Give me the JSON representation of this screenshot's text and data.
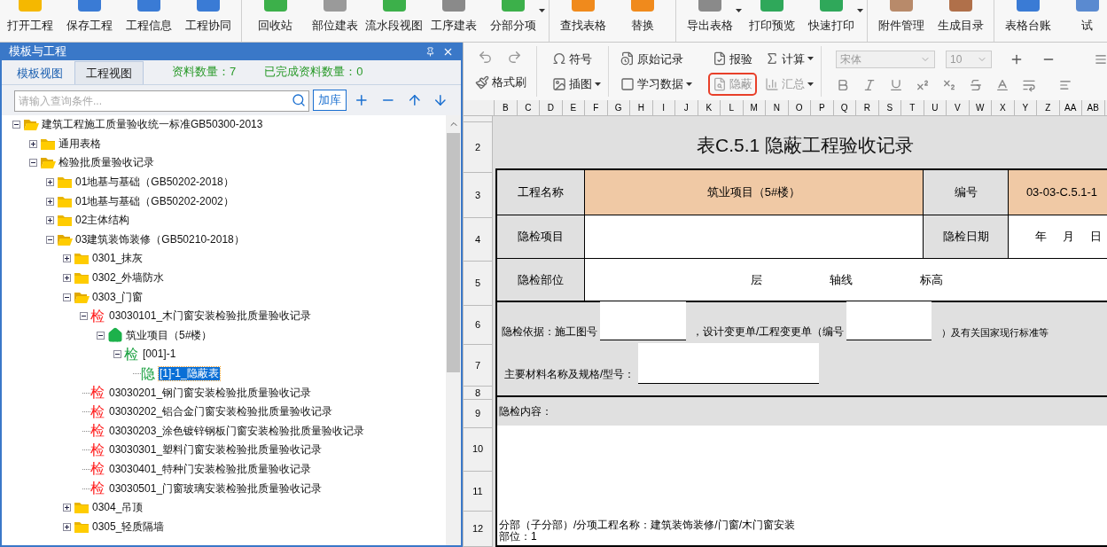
{
  "ribbon": {
    "groups": [
      [
        {
          "label": "打开工程",
          "dropdown": false
        },
        {
          "label": "保存工程",
          "dropdown": false
        },
        {
          "label": "工程信息",
          "dropdown": false
        },
        {
          "label": "工程协同",
          "dropdown": false
        }
      ],
      [
        {
          "label": "回收站",
          "dropdown": false
        },
        {
          "label": "部位建表",
          "dropdown": false
        },
        {
          "label": "流水段视图",
          "dropdown": false
        },
        {
          "label": "工序建表",
          "dropdown": false
        },
        {
          "label": "分部分项",
          "dropdown": true
        }
      ],
      [
        {
          "label": "查找表格",
          "dropdown": false
        },
        {
          "label": "替换",
          "dropdown": false
        }
      ],
      [
        {
          "label": "导出表格",
          "dropdown": true
        },
        {
          "label": "打印预览",
          "dropdown": false
        },
        {
          "label": "快速打印",
          "dropdown": true
        }
      ],
      [
        {
          "label": "附件管理",
          "dropdown": false
        },
        {
          "label": "生成目录",
          "dropdown": false
        }
      ],
      [
        {
          "label": "表格台账",
          "dropdown": false
        },
        {
          "label": "试",
          "dropdown": false
        }
      ]
    ]
  },
  "left_panel": {
    "title": "模板与工程",
    "tabs": [
      {
        "label": "模板视图",
        "selected": true
      },
      {
        "label": "工程视图",
        "selected": false
      }
    ],
    "counts": [
      "资料数量：7",
      "已完成资料数量：0"
    ],
    "search": {
      "placeholder": "请输入查询条件..."
    },
    "add_button": "加库",
    "tree": [
      {
        "label": "建筑工程施工质量验收统一标准GB50300-2013",
        "kind": "folder",
        "expanded": true,
        "selected": false,
        "children": [
          {
            "label": "通用表格",
            "kind": "folder",
            "expanded": false,
            "selected": false
          },
          {
            "label": "检验批质量验收记录",
            "kind": "folder",
            "expanded": true,
            "selected": false,
            "children": [
              {
                "label": "01地基与基础（GB50202-2018）",
                "kind": "folder",
                "expanded": false,
                "selected": false
              },
              {
                "label": "01地基与基础（GB50202-2002）",
                "kind": "folder",
                "expanded": false,
                "selected": false
              },
              {
                "label": "02主体结构",
                "kind": "folder",
                "expanded": false,
                "selected": false
              },
              {
                "label": "03建筑装饰装修（GB50210-2018）",
                "kind": "folder",
                "expanded": true,
                "selected": false,
                "children": [
                  {
                    "label": "0301_抹灰",
                    "kind": "folder",
                    "expanded": false,
                    "selected": false
                  },
                  {
                    "label": "0302_外墙防水",
                    "kind": "folder",
                    "expanded": false,
                    "selected": false
                  },
                  {
                    "label": "0303_门窗",
                    "kind": "folder",
                    "expanded": true,
                    "selected": false,
                    "children": [
                      {
                        "label": "03030101_木门窗安装检验批质量验收记录",
                        "kind": "record",
                        "badge": "检",
                        "color": "#ff2020",
                        "expanded": true,
                        "selected": false,
                        "children": [
                          {
                            "label": "筑业项目（5#楼）",
                            "kind": "project",
                            "expanded": true,
                            "selected": false,
                            "children": [
                              {
                                "label": "[001]-1",
                                "kind": "record",
                                "badge": "检",
                                "color": "#1aa040",
                                "expanded": true,
                                "selected": false,
                                "children": [
                                  {
                                    "label": "[1]-1_隐蔽表",
                                    "kind": "record",
                                    "badge": "隐",
                                    "color": "#1aa040",
                                    "selected": true
                                  }
                                ]
                              }
                            ]
                          }
                        ]
                      },
                      {
                        "label": "03030201_钢门窗安装检验批质量验收记录",
                        "kind": "record",
                        "badge": "检",
                        "color": "#ff2020",
                        "selected": false
                      },
                      {
                        "label": "03030202_铝合金门窗安装检验批质量验收记录",
                        "kind": "record",
                        "badge": "检",
                        "color": "#ff2020",
                        "selected": false
                      },
                      {
                        "label": "03030203_涂色镀锌钢板门窗安装检验批质量验收记录",
                        "kind": "record",
                        "badge": "检",
                        "color": "#ff2020",
                        "selected": false
                      },
                      {
                        "label": "03030301_塑料门窗安装检验批质量验收记录",
                        "kind": "record",
                        "badge": "检",
                        "color": "#ff2020",
                        "selected": false
                      },
                      {
                        "label": "03030401_特种门安装检验批质量验收记录",
                        "kind": "record",
                        "badge": "检",
                        "color": "#ff2020",
                        "selected": false
                      },
                      {
                        "label": "03030501_门窗玻璃安装检验批质量验收记录",
                        "kind": "record",
                        "badge": "检",
                        "color": "#ff2020",
                        "selected": false
                      }
                    ]
                  },
                  {
                    "label": "0304_吊顶",
                    "kind": "folder",
                    "expanded": false,
                    "selected": false
                  },
                  {
                    "label": "0305_轻质隔墙",
                    "kind": "folder",
                    "expanded": false,
                    "selected": false
                  }
                ]
              }
            ]
          }
        ]
      }
    ]
  },
  "toolbar": {
    "buttons": [
      {
        "label": "符号",
        "dropdown": false,
        "disabled": false,
        "highlighted": false
      },
      {
        "label": "原始记录",
        "dropdown": false,
        "disabled": false,
        "highlighted": false
      },
      {
        "label": "报验",
        "dropdown": false,
        "disabled": false,
        "highlighted": false
      },
      {
        "label": "计算",
        "dropdown": true,
        "disabled": false,
        "highlighted": false
      },
      {
        "label": "格式刷",
        "dropdown": false,
        "disabled": false,
        "highlighted": false
      },
      {
        "label": "插图",
        "dropdown": true,
        "disabled": false,
        "highlighted": false
      },
      {
        "label": "学习数据",
        "dropdown": true,
        "disabled": false,
        "highlighted": false
      },
      {
        "label": "隐蔽",
        "dropdown": false,
        "disabled": true,
        "highlighted": true
      },
      {
        "label": "汇总",
        "dropdown": true,
        "disabled": true,
        "highlighted": false
      }
    ],
    "font": "宋体",
    "size": "10"
  },
  "sheet": {
    "columns": [
      "B",
      "C",
      "D",
      "E",
      "F",
      "G",
      "H",
      "I",
      "J",
      "K",
      "L",
      "M",
      "N",
      "O",
      "P",
      "Q",
      "R",
      "S",
      "T",
      "U",
      "V",
      "W",
      "X",
      "Y",
      "Z",
      "AA",
      "AB"
    ],
    "rows": [
      "2",
      "3",
      "4",
      "5",
      "6",
      "7",
      "8",
      "9",
      "10",
      "11",
      "12"
    ],
    "form": {
      "title": "表C.5.1 隐蔽工程验收记录",
      "project": {
        "label": "工程名称",
        "value": "筑业项目（5#楼）",
        "number_label": "编号",
        "number": "03-03-C.5.1-1"
      },
      "item": {
        "label": "隐检项目",
        "date_label": "隐检日期",
        "date_parts": [
          "年",
          "月",
          "日"
        ]
      },
      "location": {
        "label": "隐检部位",
        "parts": [
          "层",
          "轴线",
          "标高"
        ]
      },
      "basis": [
        "隐检依据：施工图号",
        "，设计变更单/工程变更单（编号",
        "）及有关国家现行标准等"
      ],
      "materials": "主要材料名称及规格/型号：",
      "content_label": "隐检内容：",
      "content_lines": [
        "分部（子分部）/分项工程名称：建筑装饰装修/门窗/木门窗安装",
        "部位：1"
      ]
    }
  }
}
